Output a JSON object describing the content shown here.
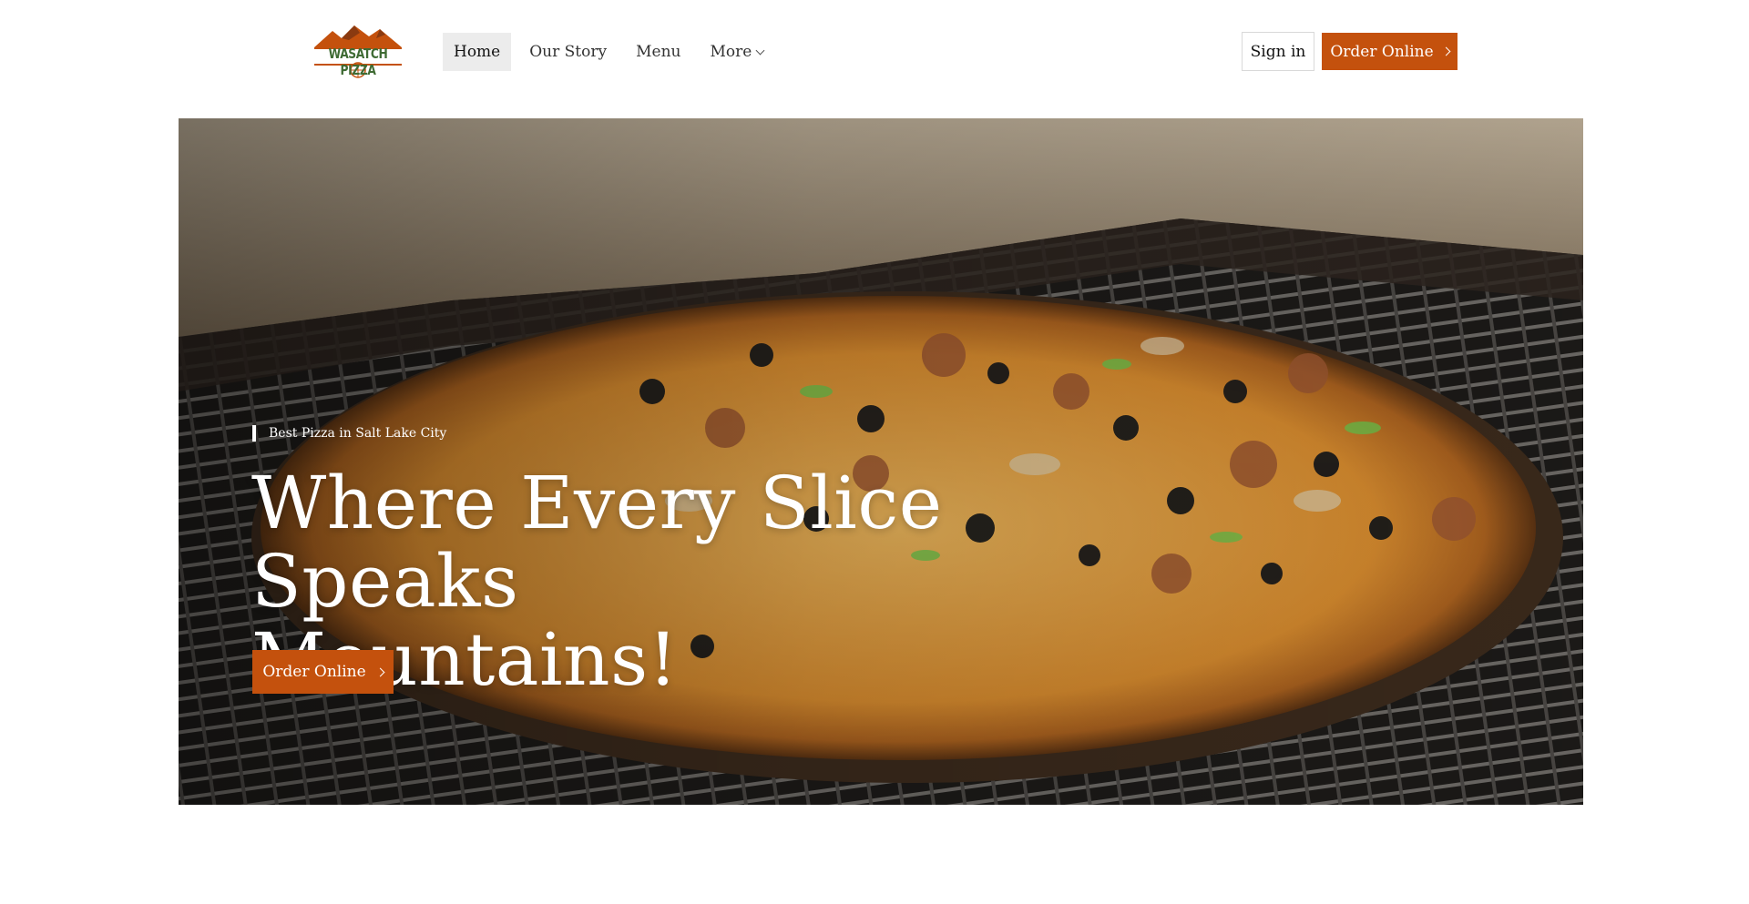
{
  "brand": {
    "logo_text": "WASATCH PIZZA",
    "primary_color": "#c4510d",
    "logo_green": "#3f6b34"
  },
  "nav": {
    "items": [
      {
        "label": "Home",
        "active": true
      },
      {
        "label": "Our Story",
        "active": false
      },
      {
        "label": "Menu",
        "active": false
      }
    ],
    "more_label": "More"
  },
  "header_actions": {
    "signin_label": "Sign in",
    "order_label": "Order Online"
  },
  "hero": {
    "eyebrow": "Best Pizza in Salt Lake City",
    "headline_line1": "Where Every Slice",
    "headline_line2": "Speaks Mountains!",
    "cta_label": "Order Online",
    "image_icon": "pizza-in-oven-photo"
  }
}
